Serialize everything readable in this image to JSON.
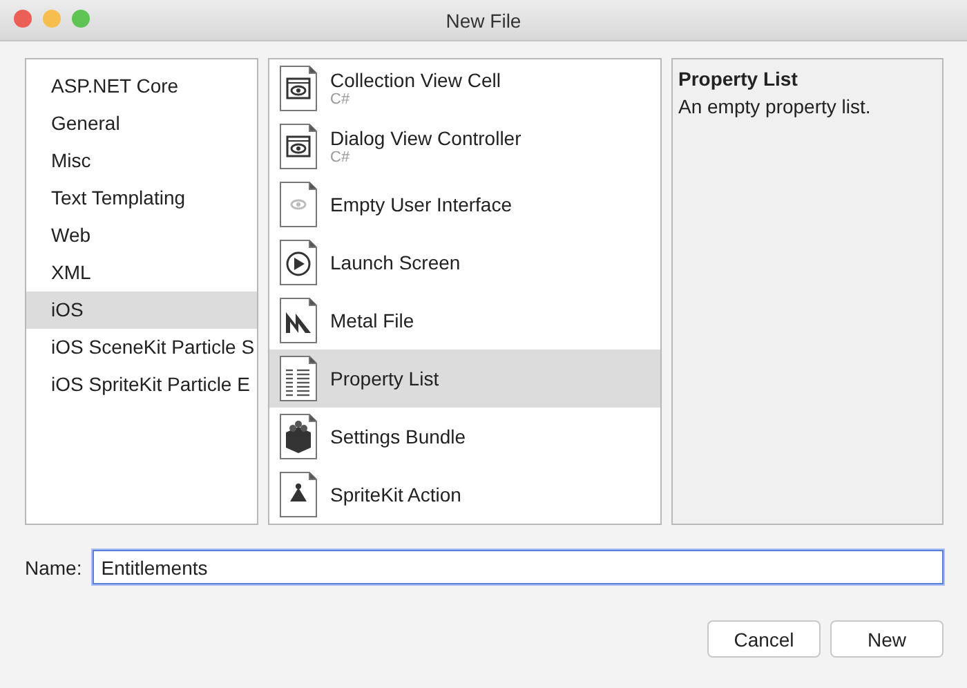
{
  "window": {
    "title": "New File"
  },
  "categories": [
    {
      "label": "ASP.NET Core",
      "selected": false
    },
    {
      "label": "General",
      "selected": false
    },
    {
      "label": "Misc",
      "selected": false
    },
    {
      "label": "Text Templating",
      "selected": false
    },
    {
      "label": "Web",
      "selected": false
    },
    {
      "label": "XML",
      "selected": false
    },
    {
      "label": "iOS",
      "selected": true
    },
    {
      "label": "iOS SceneKit Particle S",
      "selected": false
    },
    {
      "label": "iOS SpriteKit Particle E",
      "selected": false
    }
  ],
  "templates": [
    {
      "label": "Collection View Cell",
      "subtitle": "C#",
      "kind": "view",
      "selected": false
    },
    {
      "label": "Dialog View Controller",
      "subtitle": "C#",
      "kind": "view",
      "selected": false
    },
    {
      "label": "Empty User Interface",
      "kind": "faint",
      "selected": false
    },
    {
      "label": "Launch Screen",
      "kind": "play",
      "selected": false
    },
    {
      "label": "Metal File",
      "kind": "metal",
      "selected": false
    },
    {
      "label": "Property List",
      "kind": "list",
      "selected": true
    },
    {
      "label": "Settings Bundle",
      "kind": "bundle",
      "selected": false
    },
    {
      "label": "SpriteKit Action",
      "kind": "sprite",
      "selected": false
    }
  ],
  "description": {
    "title": "Property List",
    "text": "An empty property list."
  },
  "name_field": {
    "label": "Name:",
    "value": "Entitlements"
  },
  "buttons": [
    "Cancel",
    "New"
  ]
}
